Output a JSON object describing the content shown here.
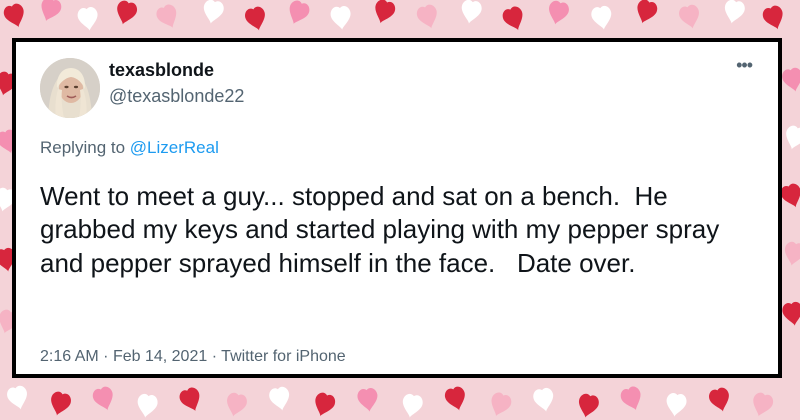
{
  "tweet": {
    "display_name": "texasblonde",
    "handle": "@texasblonde22",
    "more_icon": "more-horizontal-icon",
    "replying_prefix": "Replying to ",
    "replying_to": "@LizerReal",
    "text": "Went to meet a guy... stopped and sat on a bench.  He grabbed my keys and started playing with my pepper spray and pepper sprayed himself in the face.   Date over.",
    "time": "2:16 AM",
    "date": "Feb 14, 2021",
    "source": "Twitter for iPhone",
    "separator": "·"
  },
  "colors": {
    "background": "#f4d3d8",
    "heart_red": "#d7263d",
    "heart_pink": "#f48fb1",
    "heart_white": "#ffffff",
    "card": "#ffffff",
    "border": "#000000",
    "text": "#0f1419",
    "muted": "#536471",
    "link": "#1d9bf0"
  }
}
